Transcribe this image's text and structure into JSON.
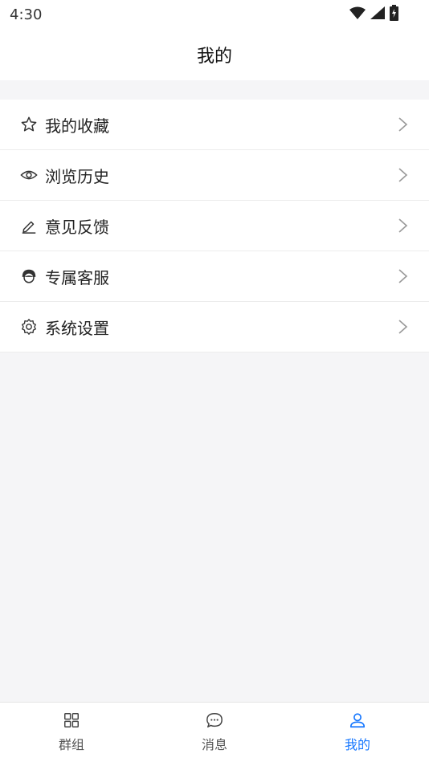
{
  "status_bar": {
    "time": "4:30"
  },
  "header": {
    "title": "我的"
  },
  "menu": {
    "items": [
      {
        "label": "我的收藏",
        "icon": "star-icon"
      },
      {
        "label": "浏览历史",
        "icon": "eye-icon"
      },
      {
        "label": "意见反馈",
        "icon": "pen-icon"
      },
      {
        "label": "专属客服",
        "icon": "customer-service-icon"
      },
      {
        "label": "系统设置",
        "icon": "gear-icon"
      }
    ]
  },
  "tabbar": {
    "tabs": [
      {
        "label": "群组",
        "icon": "grid-icon",
        "active": false
      },
      {
        "label": "消息",
        "icon": "chat-bubble-icon",
        "active": false
      },
      {
        "label": "我的",
        "icon": "user-icon",
        "active": true
      }
    ]
  },
  "colors": {
    "accent": "#1677ff",
    "background": "#f5f5f7",
    "divider": "#ececec"
  }
}
